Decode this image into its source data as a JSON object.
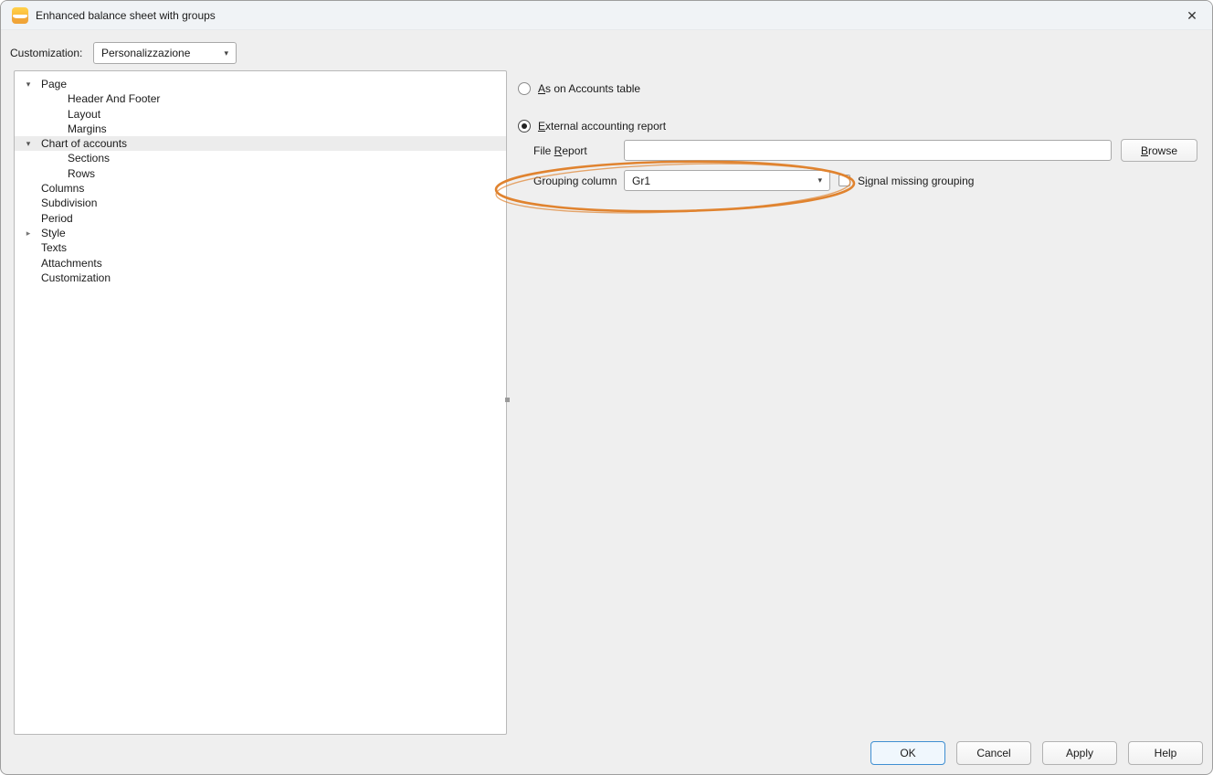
{
  "window": {
    "title": "Enhanced balance sheet with groups"
  },
  "icons": {
    "close": "✕",
    "dropdown": "▾",
    "expanded": "▾",
    "collapsed": "▸"
  },
  "customization": {
    "label": "Customization:",
    "value": "Personalizzazione"
  },
  "tree": {
    "items": [
      {
        "label": "Page",
        "level": 0,
        "state": "expanded"
      },
      {
        "label": "Header And Footer",
        "level": 1
      },
      {
        "label": "Layout",
        "level": 1
      },
      {
        "label": "Margins",
        "level": 1
      },
      {
        "label": "Chart of accounts",
        "level": 0,
        "state": "expanded",
        "selected": true
      },
      {
        "label": "Sections",
        "level": 1
      },
      {
        "label": "Rows",
        "level": 1
      },
      {
        "label": "Columns",
        "level": 0
      },
      {
        "label": "Subdivision",
        "level": 0
      },
      {
        "label": "Period",
        "level": 0
      },
      {
        "label": "Style",
        "level": 0,
        "state": "collapsed"
      },
      {
        "label": "Texts",
        "level": 0
      },
      {
        "label": "Attachments",
        "level": 0
      },
      {
        "label": "Customization",
        "level": 0
      }
    ]
  },
  "panel": {
    "radio_accounts": {
      "pre": "",
      "key": "A",
      "post": "s on Accounts table",
      "selected": false
    },
    "radio_external": {
      "pre": "",
      "key": "E",
      "post": "xternal accounting report",
      "selected": true
    },
    "file_report": {
      "label_pre": "File ",
      "label_key": "R",
      "label_post": "eport",
      "value": "",
      "browse_key": "B",
      "browse_post": "rowse"
    },
    "grouping": {
      "label": "Grouping column",
      "value": "Gr1",
      "checkbox_pre": "S",
      "checkbox_key": "i",
      "checkbox_post": "gnal missing grouping",
      "checked": false
    }
  },
  "annotation": {
    "color": "#e0832f"
  },
  "footer": {
    "ok": "OK",
    "cancel": "Cancel",
    "apply": "Apply",
    "help": "Help"
  }
}
